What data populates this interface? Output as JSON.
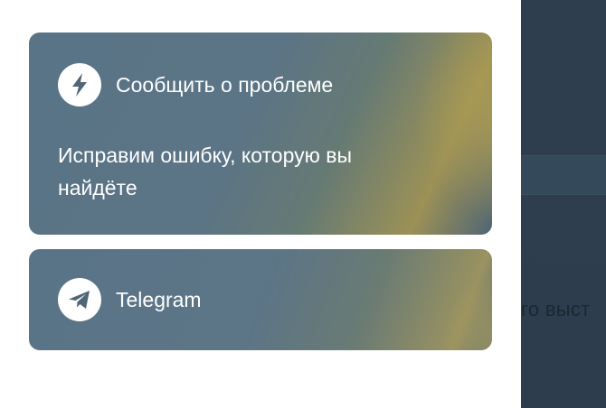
{
  "cards": {
    "report": {
      "title": "Сообщить о проблеме",
      "description": "Исправим ошибку, которую вы найдёте",
      "icon": "lightning-icon"
    },
    "telegram": {
      "title": "Telegram",
      "icon": "telegram-icon"
    }
  },
  "background": {
    "peek_text": "го выст"
  },
  "colors": {
    "icon_fill": "#4f6676",
    "card_text": "#ffffff",
    "backdrop": "#2e3e4e"
  }
}
